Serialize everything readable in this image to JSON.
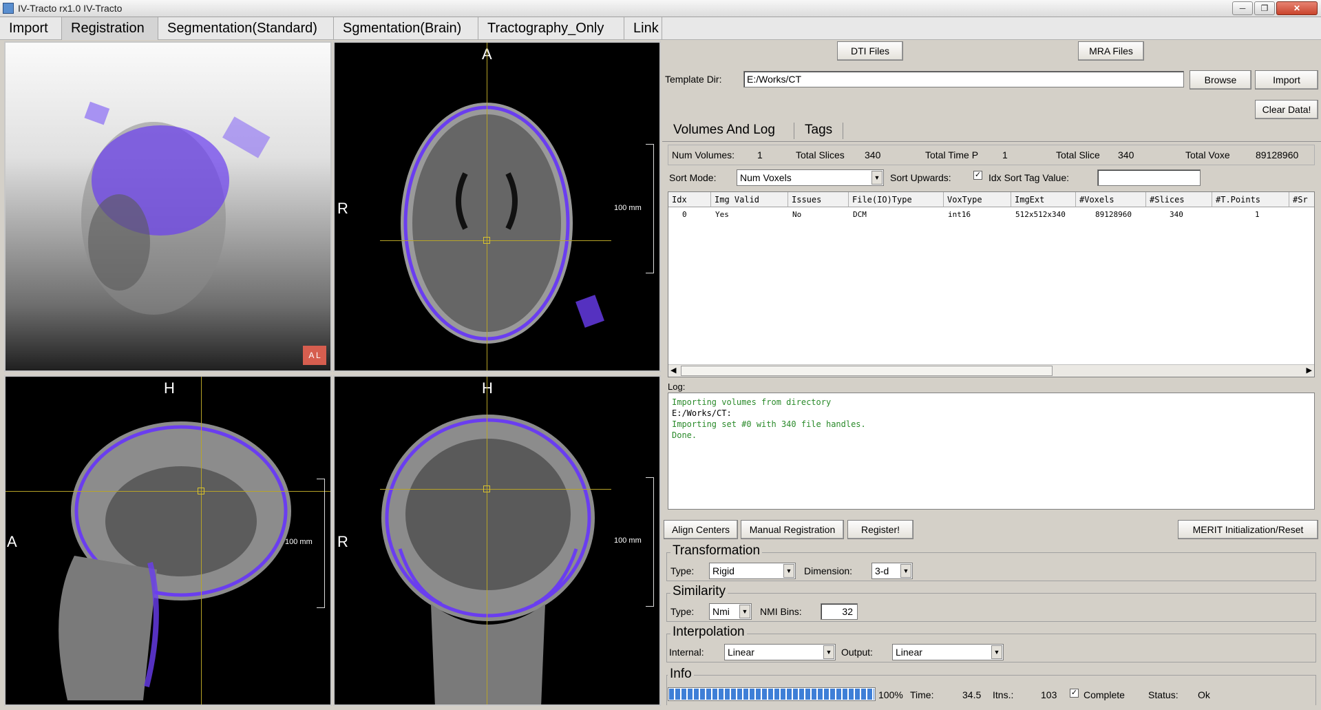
{
  "window": {
    "title": "IV-Tracto rx1.0 IV-Tracto",
    "controls": [
      "─",
      "❐",
      "✕"
    ]
  },
  "menu": {
    "tabs": [
      "Import",
      "Registration",
      "Segmentation(Standard)",
      "Sgmentation(Brain)",
      "Tractography_Only",
      "Link"
    ],
    "active": "Registration"
  },
  "views": {
    "axial": {
      "top": "A",
      "left": "R",
      "scale": "100 mm"
    },
    "sagittal": {
      "top": "H",
      "left": "A",
      "scale": "100 mm"
    },
    "coronal": {
      "top": "H",
      "left": "R",
      "scale": "100 mm"
    },
    "vr_cube": "A L"
  },
  "buttons": {
    "dti_files": "DTI Files",
    "mra_files": "MRA Files",
    "browse": "Browse",
    "import": "Import",
    "clear_data": "Clear Data!",
    "align_centers": "Align Centers",
    "manual_registration": "Manual Registration",
    "register": "Register!",
    "merit_init": "MERIT Initialization/Reset"
  },
  "template": {
    "label": "Template Dir:",
    "value": "E:/Works/CT"
  },
  "tabs": [
    "Volumes And Log",
    "Tags"
  ],
  "summary": {
    "num_volumes_label": "Num Volumes:",
    "num_volumes": "1",
    "total_slices_label": "Total Slices",
    "total_slices": "340",
    "total_time_label": "Total Time P",
    "total_time": "1",
    "total_slice2_label": "Total Slice",
    "total_slice2": "340",
    "total_voxels_label": "Total Voxe",
    "total_voxels": "89128960"
  },
  "sort": {
    "mode_label": "Sort Mode:",
    "mode_value": "Num Voxels",
    "upwards_label": "Sort Upwards:",
    "upwards_checked": "✓",
    "tag_label": "Idx Sort Tag Value:",
    "tag_value": ""
  },
  "table": {
    "headers": [
      "Idx",
      "Img Valid",
      "Issues",
      "File(IO)Type",
      "VoxType",
      "ImgExt",
      "#Voxels",
      "#Slices",
      "#T.Points",
      "#Sr"
    ],
    "rows": [
      [
        "0",
        "Yes",
        "No",
        "DCM",
        "int16",
        "512x512x340",
        "89128960",
        "340",
        "1",
        ""
      ]
    ],
    "scroll_left": "◀",
    "scroll_right": "▶"
  },
  "log": {
    "label": "Log:",
    "lines": [
      "Importing volumes from directory",
      "E:/Works/CT:",
      "Importing set #0 with 340 file handles.",
      "Done."
    ]
  },
  "transformation": {
    "title": "Transformation",
    "type_label": "Type:",
    "type_value": "Rigid",
    "dimension_label": "Dimension:",
    "dimension_value": "3-d"
  },
  "similarity": {
    "title": "Similarity",
    "type_label": "Type:",
    "type_value": "Nmi",
    "bins_label": "NMI Bins:",
    "bins_value": "32"
  },
  "interpolation": {
    "title": "Interpolation",
    "internal_label": "Internal:",
    "internal_value": "Linear",
    "output_label": "Output:",
    "output_value": "Linear"
  },
  "info": {
    "title": "Info",
    "progress": 1.0,
    "progress_text": "100%",
    "time_label": "Time:",
    "time_value": "34.5",
    "itns_label": "Itns.:",
    "itns_value": "103",
    "complete_label": "Complete",
    "complete_checked": "✓",
    "status_label": "Status:",
    "status_value": "Ok"
  },
  "colors": {
    "overlay": "#6a3df0",
    "crosshair": "#b8a428",
    "log_text": "#2a8a2a",
    "progress": "#3e7fd7"
  }
}
